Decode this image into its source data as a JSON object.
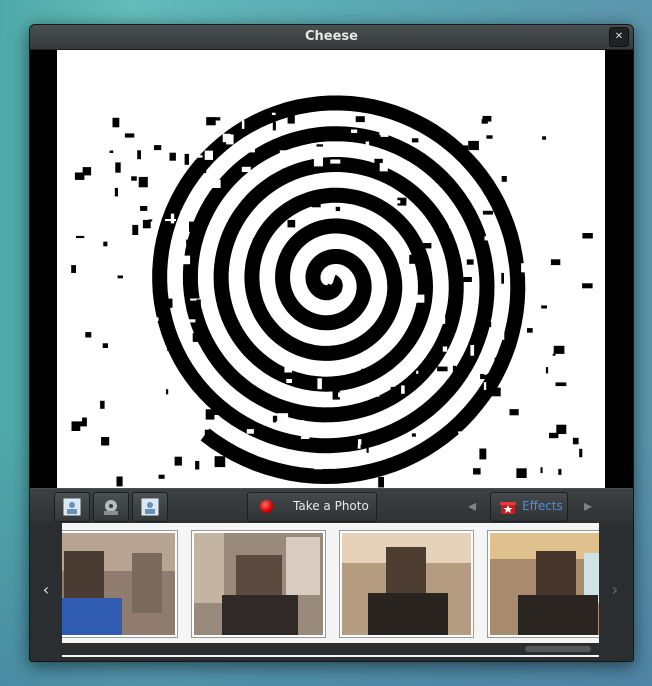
{
  "window": {
    "title": "Cheese",
    "close_glyph": "✕"
  },
  "toolbar": {
    "modes": [
      {
        "name": "photo-mode-button",
        "icon": "photo-icon"
      },
      {
        "name": "video-mode-button",
        "icon": "film-reel-icon"
      },
      {
        "name": "burst-mode-button",
        "icon": "photo-burst-icon"
      }
    ],
    "take_photo_label": "Take a Photo",
    "prev_effect_glyph": "◂",
    "next_effect_glyph": "▸",
    "effects_label": "Effects"
  },
  "thumbnails": {
    "prev_glyph": "‹",
    "next_glyph": "›",
    "count_visible": 4
  },
  "colors": {
    "accent": "#4a8fd8",
    "record_red": "#d40000",
    "window_bg": "#2b2e30"
  },
  "viewport": {
    "effect": "spiral",
    "active": true
  }
}
